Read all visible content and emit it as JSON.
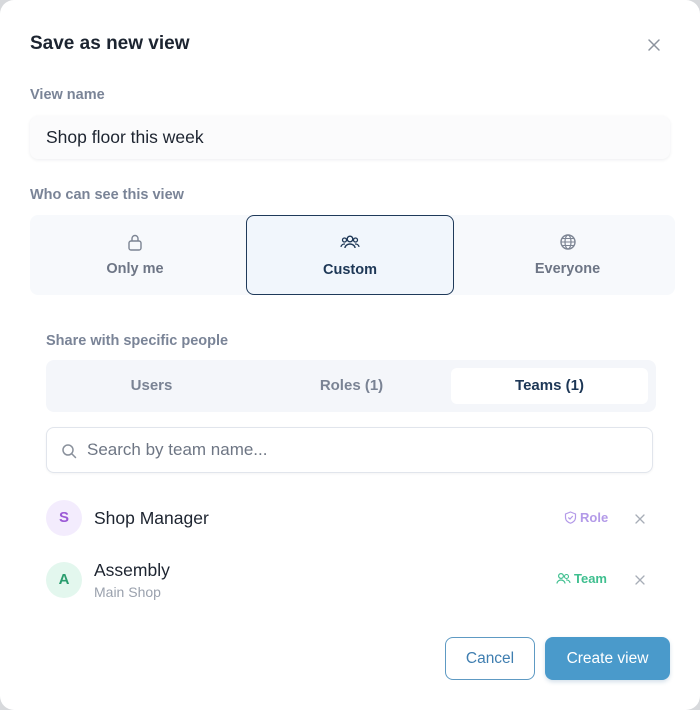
{
  "dialog": {
    "title": "Save as new view",
    "close_icon": "close-icon"
  },
  "view_name": {
    "label": "View name",
    "value": "Shop floor this week"
  },
  "visibility": {
    "label": "Who can see this view",
    "options": [
      {
        "label": "Only me",
        "icon": "lock-icon"
      },
      {
        "label": "Custom",
        "icon": "people-icon"
      },
      {
        "label": "Everyone",
        "icon": "globe-icon"
      }
    ],
    "selected": "Custom"
  },
  "share": {
    "label": "Share with specific people",
    "tabs": [
      {
        "label": "Users"
      },
      {
        "label": "Roles (1)"
      },
      {
        "label": "Teams (1)"
      }
    ],
    "active_tab": "Teams (1)",
    "search_placeholder": "Search by team name..."
  },
  "members": [
    {
      "initial": "S",
      "name": "Shop Manager",
      "subtitle": "",
      "badge": "Role",
      "badge_icon": "shield-icon",
      "badge_color": "#b39ae8",
      "avatar_bg": "#f3ecfd",
      "avatar_color": "#9b59d6"
    },
    {
      "initial": "A",
      "name": "Assembly",
      "subtitle": "Main Shop",
      "badge": "Team",
      "badge_icon": "team-icon",
      "badge_color": "#3fbf8f",
      "avatar_bg": "#e3f7ee",
      "avatar_color": "#2a9d6e"
    }
  ],
  "footer": {
    "cancel_label": "Cancel",
    "create_label": "Create view"
  },
  "colors": {
    "accent": "#4a9acb",
    "selected_border": "#1f3a5a"
  }
}
